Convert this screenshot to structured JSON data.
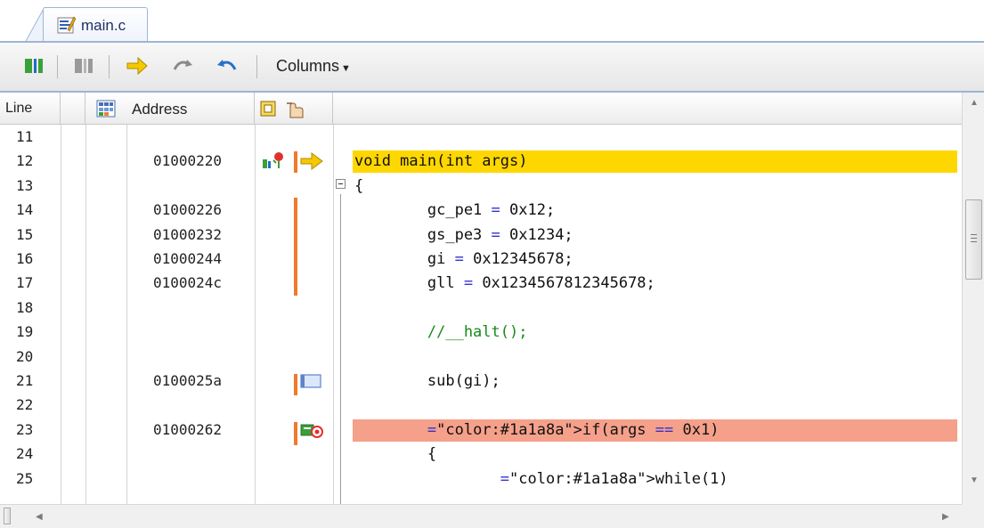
{
  "tab": {
    "label": "main.c"
  },
  "toolbar": {
    "columns_label": "Columns"
  },
  "header": {
    "line_label": "Line",
    "address_label": "Address"
  },
  "colors": {
    "current_line": "#ffd700",
    "breakpoint_line": "#f5a08a",
    "coverage_bar": "#f07a2c",
    "comment": "#1a8a1a",
    "keyword_blue": "#3333cc"
  },
  "rows": [
    {
      "line": "11",
      "address": "",
      "code": ""
    },
    {
      "line": "12",
      "address": "01000220",
      "code": "void main(int args)"
    },
    {
      "line": "13",
      "address": "",
      "code": "{"
    },
    {
      "line": "14",
      "address": "01000226",
      "code": "        gc_pe1 = 0x12;"
    },
    {
      "line": "15",
      "address": "01000232",
      "code": "        gs_pe3 = 0x1234;"
    },
    {
      "line": "16",
      "address": "01000244",
      "code": "        gi = 0x12345678;"
    },
    {
      "line": "17",
      "address": "0100024c",
      "code": "        gll = 0x1234567812345678;"
    },
    {
      "line": "18",
      "address": "",
      "code": ""
    },
    {
      "line": "19",
      "address": "",
      "code": "        //__halt();"
    },
    {
      "line": "20",
      "address": "",
      "code": ""
    },
    {
      "line": "21",
      "address": "0100025a",
      "code": "        sub(gi);"
    },
    {
      "line": "22",
      "address": "",
      "code": ""
    },
    {
      "line": "23",
      "address": "01000262",
      "code": "        if(args == 0x1)"
    },
    {
      "line": "24",
      "address": "",
      "code": "        {"
    },
    {
      "line": "25",
      "address": "",
      "code": "                while(1)"
    }
  ]
}
